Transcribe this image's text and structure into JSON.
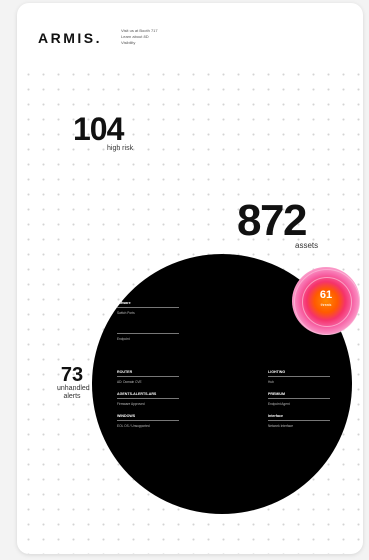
{
  "brand": {
    "logo": "ARMIS."
  },
  "header": {
    "visit_lines": [
      "Visit us at Booth 717",
      "Learn about 8D",
      "Visibility"
    ]
  },
  "stats": {
    "high_risk": {
      "value": "104",
      "label": "high risk"
    },
    "assets": {
      "value": "872",
      "label": "assets"
    },
    "unhandled": {
      "value": "73",
      "label_line1": "unhandled",
      "label_line2": "alerts"
    }
  },
  "highlight": {
    "value": "61",
    "label": "threats"
  },
  "circle_items": {
    "vmware": {
      "title": "VMware",
      "sub1": "Switch Ports",
      "sub2": "Endpoint"
    },
    "router": {
      "title": "ROUTER",
      "sub": "AD: Domain CVE"
    },
    "agents": {
      "title": "AGENTS-ALERTS-ARS",
      "sub": "Firmware Approved"
    },
    "windows": {
      "title": "WINDOWS",
      "sub": "EOL OS / Unsupported"
    },
    "lighting": {
      "title": "LIGHTING",
      "sub": "Hub"
    },
    "premium": {
      "title": "PREMIUM",
      "sub": "Endpoint Agent"
    },
    "interface": {
      "title": "Interface",
      "sub": "Network Interface"
    }
  }
}
